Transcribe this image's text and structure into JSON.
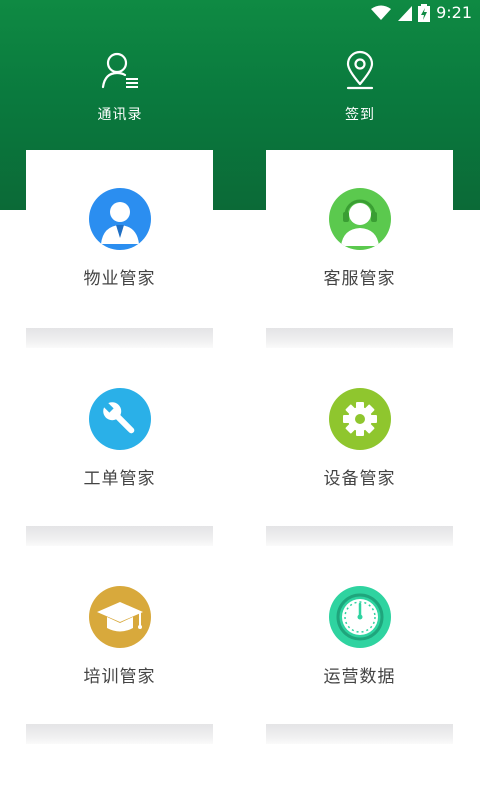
{
  "status_bar": {
    "time": "9:21",
    "icons": [
      "wifi-icon",
      "cell-signal-icon",
      "battery-charging-icon"
    ]
  },
  "top_actions": [
    {
      "label": "通讯录",
      "icon": "contacts-icon"
    },
    {
      "label": "签到",
      "icon": "location-pin-icon"
    }
  ],
  "modules": [
    {
      "label": "物业管家",
      "icon": "property-manager-icon",
      "color": "#2b8ef0"
    },
    {
      "label": "客服管家",
      "icon": "customer-service-icon",
      "color": "#5bc94e"
    },
    {
      "label": "工单管家",
      "icon": "wrench-icon",
      "color": "#2ab0e8"
    },
    {
      "label": "设备管家",
      "icon": "gear-icon",
      "color": "#8fc62e"
    },
    {
      "label": "培训管家",
      "icon": "graduation-cap-icon",
      "color": "#d8a93c"
    },
    {
      "label": "运营数据",
      "icon": "dial-icon",
      "color": "#2fd3a0"
    }
  ],
  "colors": {
    "header": "#0a7a3e"
  }
}
